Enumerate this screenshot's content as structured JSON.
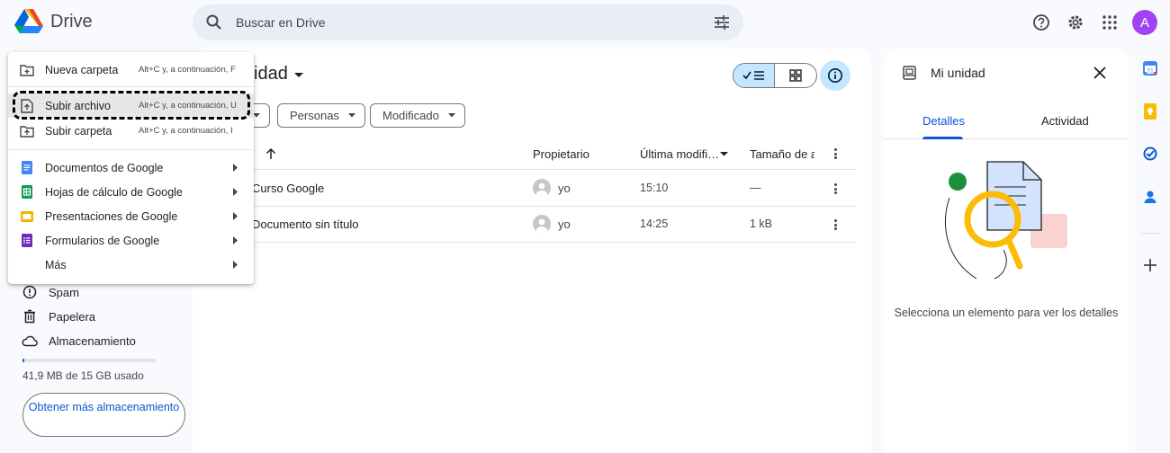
{
  "app": {
    "name": "Drive",
    "avatar_letter": "A"
  },
  "search": {
    "placeholder": "Buscar en Drive"
  },
  "header_icons": [
    "help-icon",
    "settings-icon",
    "apps-grid-icon"
  ],
  "nav": {
    "items": [
      {
        "label": "Spam",
        "icon": "spam-icon"
      },
      {
        "label": "Papelera",
        "icon": "trash-icon"
      },
      {
        "label": "Almacenamiento",
        "icon": "cloud-icon"
      }
    ],
    "storage_text": "41,9 MB de 15 GB usado",
    "storage_fraction": 0.003,
    "storage_button": "Obtener más almacenamiento"
  },
  "main": {
    "title": "idad",
    "filters": [
      "Personas",
      "Modificado"
    ],
    "columns": {
      "owner": "Propietario",
      "modified": "Última modifi…",
      "size": "Tamaño de a"
    },
    "rows": [
      {
        "name": "Curso Google",
        "owner": "yo",
        "modified": "15:10",
        "size": "—"
      },
      {
        "name": "Documento sin título",
        "owner": "yo",
        "modified": "14:25",
        "size": "1 kB"
      }
    ]
  },
  "details": {
    "title": "Mi unidad",
    "tabs": [
      "Detalles",
      "Actividad"
    ],
    "empty_message": "Selecciona un elemento para ver los detalles"
  },
  "new_menu": {
    "items": [
      {
        "label": "Nueva carpeta",
        "shortcut": "Alt+C y, a continuación, F",
        "icon": "new-folder-icon"
      },
      {
        "label": "Subir archivo",
        "shortcut": "Alt+C y, a continuación, U",
        "icon": "file-upload-icon"
      },
      {
        "label": "Subir carpeta",
        "shortcut": "Alt+C y, a continuación, I",
        "icon": "folder-upload-icon"
      },
      {
        "label": "Documentos de Google",
        "icon": "docs-icon"
      },
      {
        "label": "Hojas de cálculo de Google",
        "icon": "sheets-icon"
      },
      {
        "label": "Presentaciones de Google",
        "icon": "slides-icon"
      },
      {
        "label": "Formularios de Google",
        "icon": "forms-icon"
      },
      {
        "label": "Más",
        "icon": ""
      }
    ]
  },
  "colors": {
    "accent": "#0b57d0",
    "selected_toggle": "#c2e7ff",
    "avatar": "#a142f4",
    "docs": "#4285f4",
    "sheets": "#0f9d58",
    "slides": "#f4b400",
    "forms": "#7627bb"
  }
}
